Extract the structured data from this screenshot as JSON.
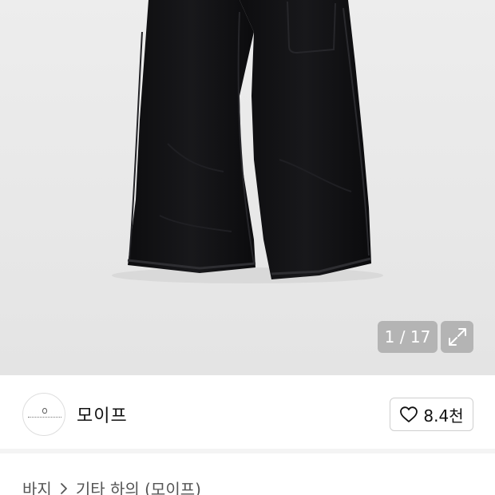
{
  "gallery": {
    "counter_text": "1 / 17",
    "background": "#e9e9e9"
  },
  "shop": {
    "name": "모이프",
    "like_count": "8.4천"
  },
  "breadcrumb": {
    "category": "바지",
    "subcategory": "기타 하의 (모이프)"
  },
  "icons": {
    "expand": "expand-icon",
    "heart": "heart-icon",
    "chevron": "chevron-right-icon"
  }
}
